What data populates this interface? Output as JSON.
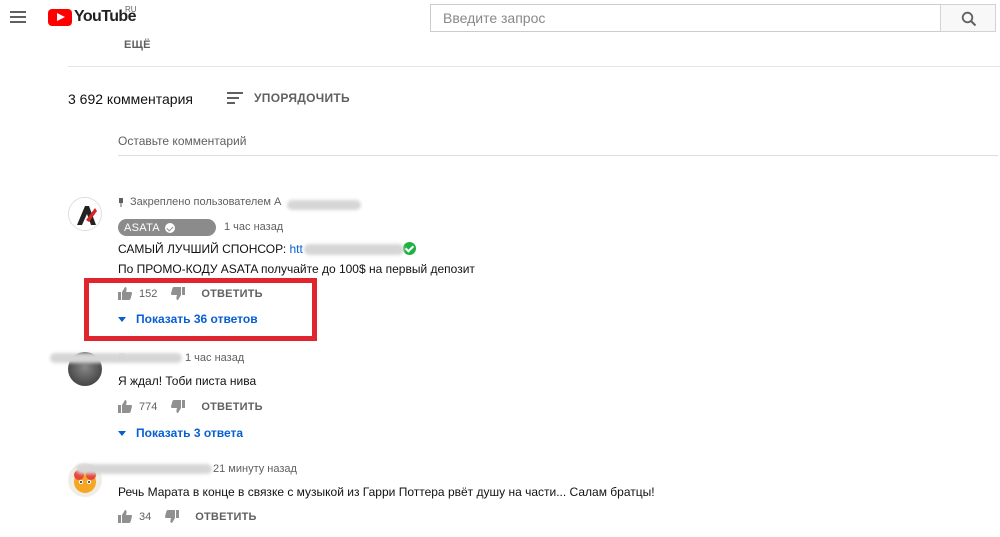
{
  "header": {
    "logo_text": "YouTube",
    "logo_country": "RU",
    "search_placeholder": "Введите запрос",
    "more_label": "ЕЩЁ"
  },
  "comments_header": {
    "count_label": "3 692 комментария",
    "sort_label": "УПОРЯДОЧИТЬ",
    "add_placeholder": "Оставьте комментарий"
  },
  "comments": [
    {
      "pinned_text": "Закреплено пользователем A",
      "author": "ASATA",
      "time": "1 час назад",
      "line1_prefix": "САМЫЙ ЛУЧШИЙ СПОНСОР: ",
      "line1_link": "htt",
      "line2": "По ПРОМО-КОДУ ASATA получайте до 100$ на первый депозит",
      "likes": "152",
      "reply_label": "ОТВЕТИТЬ",
      "show_replies": "Показать 36 ответов"
    },
    {
      "author": "R",
      "time": "1 час назад",
      "text": "Я ждал! Тоби писта нива",
      "likes": "774",
      "reply_label": "ОТВЕТИТЬ",
      "show_replies": "Показать 3 ответа"
    },
    {
      "author": "",
      "time": "21 минуту назад",
      "text": "Речь Марата в конце в связке с музыкой из Гарри Поттера рвёт душу на части... Салам братцы!",
      "likes": "34",
      "reply_label": "ОТВЕТИТЬ"
    }
  ],
  "colors": {
    "highlight_box": "#e0252f",
    "link_blue": "#065fd4",
    "youtube_red": "#ff0000"
  }
}
